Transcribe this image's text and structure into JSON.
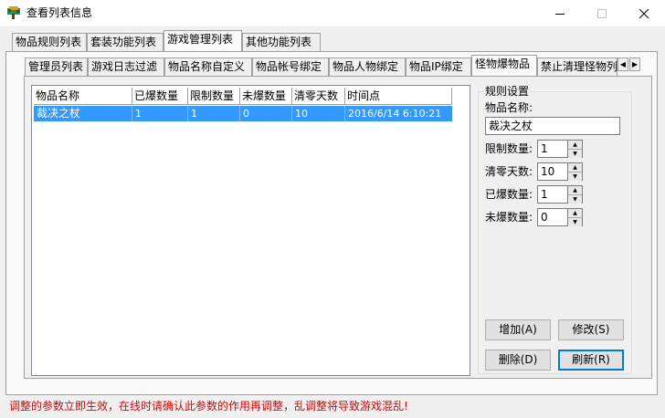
{
  "window": {
    "title": "查看列表信息",
    "icon": "tree-app-icon"
  },
  "outer_tabs": [
    {
      "label": "物品规则列表"
    },
    {
      "label": "套装功能列表"
    },
    {
      "label": "游戏管理列表"
    },
    {
      "label": "其他功能列表"
    }
  ],
  "inner_tabs": [
    {
      "label": "管理员列表"
    },
    {
      "label": "游戏日志过滤"
    },
    {
      "label": "物品名称自定义"
    },
    {
      "label": "物品帐号绑定"
    },
    {
      "label": "物品人物绑定"
    },
    {
      "label": "物品IP绑定"
    },
    {
      "label": "怪物爆物品"
    },
    {
      "label": "禁止清理怪物列"
    }
  ],
  "table": {
    "columns": [
      "物品名称",
      "已爆数量",
      "限制数量",
      "未爆数量",
      "清零天数",
      "时间点"
    ],
    "rows": [
      [
        "裁决之杖",
        "1",
        "1",
        "0",
        "10",
        "2016/6/14 6:10:21"
      ]
    ]
  },
  "settings": {
    "group_title": "规则设置",
    "item_name_label": "物品名称:",
    "item_name_value": "裁决之杖",
    "limit_label": "限制数量:",
    "limit_value": "1",
    "reset_days_label": "清零天数:",
    "reset_days_value": "10",
    "dropped_label": "已爆数量:",
    "dropped_value": "1",
    "undropped_label": "未爆数量:",
    "undropped_value": "0"
  },
  "buttons": {
    "add": "增加(A)",
    "edit": "修改(S)",
    "delete": "删除(D)",
    "refresh": "刷新(R)"
  },
  "status": "调整的参数立即生效，在线时请确认此参数的作用再调整，乱调整将导致游戏混乱!",
  "colors": {
    "selection": "#3399ff",
    "status_text": "#e00000",
    "focus": "#0078d7"
  }
}
